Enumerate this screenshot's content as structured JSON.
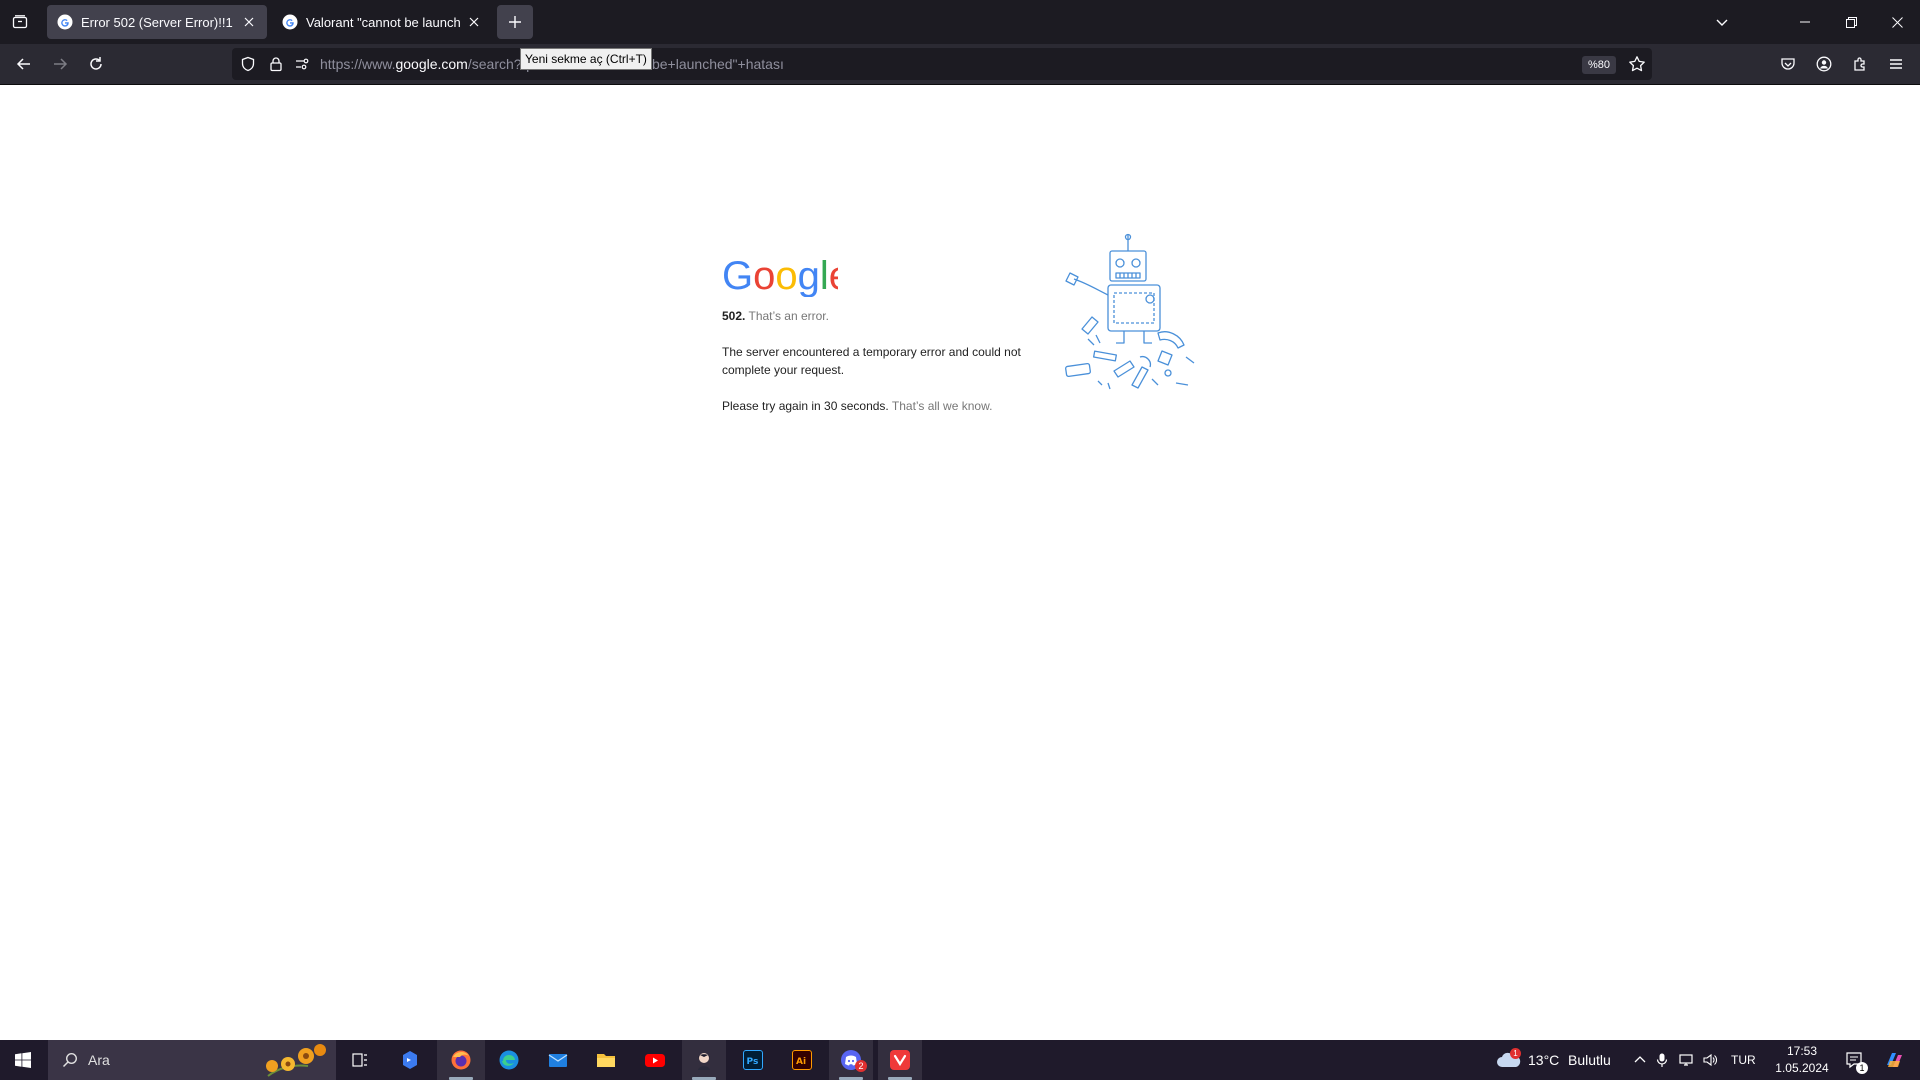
{
  "browser": {
    "tabs": [
      {
        "title": "Error 502 (Server Error)!!1",
        "active": true
      },
      {
        "title": "Valorant \"cannot be launched\" ",
        "active": false
      }
    ],
    "new_tab_tooltip": "Yeni sekme aç (Ctrl+T)",
    "url": {
      "prefix": "https://www.",
      "host": "google.com",
      "path": "/search?q=Valorant+\"cannot+be+launched\"+hatası"
    },
    "zoom": "%80"
  },
  "page": {
    "logo_text": "Google",
    "error_code": "502.",
    "error_title": "That’s an error.",
    "message": "The server encountered a temporary error and could not complete your request.",
    "retry": "Please try again in 30 seconds.",
    "retry_note": "That’s all we know."
  },
  "taskbar": {
    "search_placeholder": "Ara",
    "weather": {
      "temp": "13°C",
      "condition": "Bulutlu",
      "badge": "1"
    },
    "language": "TUR",
    "time": "17:53",
    "date": "1.05.2024",
    "notification_count": "1",
    "discord_badge": "2"
  },
  "colors": {
    "chrome_dark": "#1c1b22",
    "toolbar": "#2b2a33",
    "active_tab": "#42414d",
    "taskbar": "#1f1a2b",
    "google_blue": "#4285F4",
    "google_red": "#EA4335",
    "google_yellow": "#FBBC05",
    "google_green": "#34A853"
  }
}
